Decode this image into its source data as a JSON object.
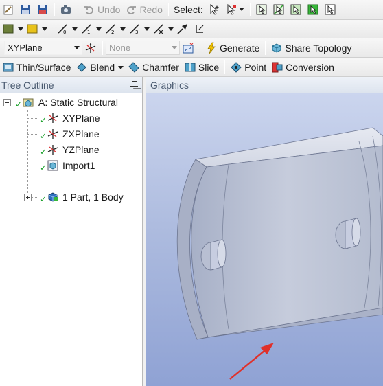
{
  "toolbar1": {
    "undo_label": "Undo",
    "redo_label": "Redo",
    "select_label": "Select:"
  },
  "toolbar3": {
    "plane_value": "XYPlane",
    "sketch_value": "None",
    "generate_label": "Generate",
    "share_topology_label": "Share Topology"
  },
  "toolbar4": {
    "thin_surface_label": "Thin/Surface",
    "blend_label": "Blend",
    "chamfer_label": "Chamfer",
    "slice_label": "Slice",
    "point_label": "Point",
    "conversion_label": "Conversion"
  },
  "tree_outline": {
    "title": "Tree Outline",
    "root": "A: Static Structural",
    "items": [
      "XYPlane",
      "ZXPlane",
      "YZPlane",
      "Import1",
      "1 Part, 1 Body"
    ]
  },
  "graphics": {
    "title": "Graphics"
  },
  "colors": {
    "model_fill": "#c9cfe0",
    "viewport_top": "#cbd5ee",
    "viewport_bottom": "#8fa2d4",
    "arrow": "#e0302a",
    "check": "#1aa02a"
  }
}
